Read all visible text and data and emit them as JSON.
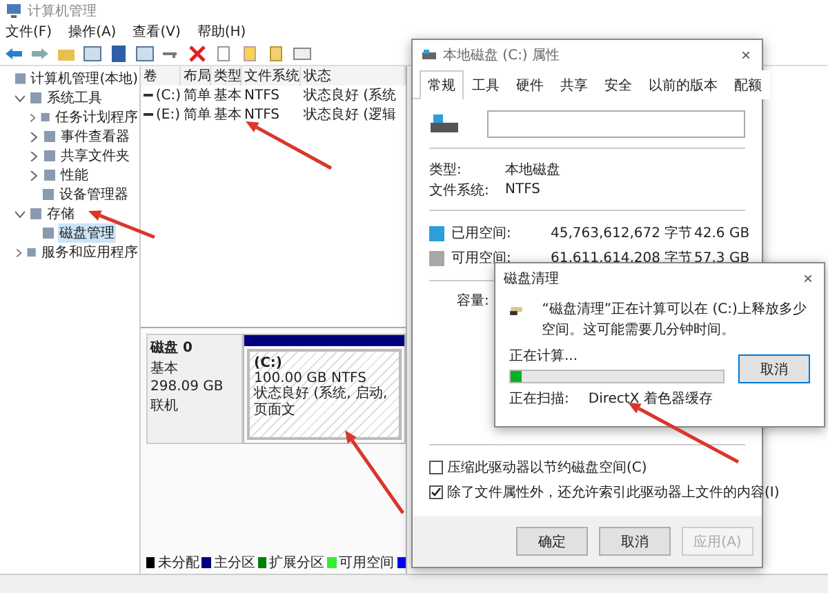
{
  "main_window": {
    "title": "计算机管理",
    "menu": [
      "文件(F)",
      "操作(A)",
      "查看(V)",
      "帮助(H)"
    ],
    "tree": [
      {
        "label": "计算机管理(本地)",
        "selected": false,
        "children": [
          {
            "label": "系统工具",
            "selected": false,
            "expanded": true,
            "children": [
              {
                "label": "任务计划程序",
                "selected": false,
                "expanded": false
              },
              {
                "label": "事件查看器",
                "selected": false,
                "expanded": false
              },
              {
                "label": "共享文件夹",
                "selected": false,
                "expanded": false
              },
              {
                "label": "性能",
                "selected": false,
                "expanded": false
              },
              {
                "label": "设备管理器",
                "selected": false
              }
            ]
          },
          {
            "label": "存储",
            "selected": false,
            "expanded": true,
            "children": [
              {
                "label": "磁盘管理",
                "selected": true
              }
            ]
          },
          {
            "label": "服务和应用程序",
            "selected": false,
            "expanded": false
          }
        ]
      }
    ],
    "volumes": {
      "columns": [
        "卷",
        "布局",
        "类型",
        "文件系统",
        "状态"
      ],
      "rows": [
        [
          "(C:)",
          "简单",
          "基本",
          "NTFS",
          "状态良好 (系统"
        ],
        [
          "(E:)",
          "简单",
          "基本",
          "NTFS",
          "状态良好 (逻辑"
        ]
      ]
    },
    "disk": {
      "name": "磁盘 0",
      "type": "基本",
      "size": "298.09 GB",
      "status": "联机",
      "partition": {
        "label": "(C:)",
        "size": "100.00 GB NTFS",
        "status": "状态良好 (系统, 启动, 页面文"
      }
    },
    "legend": [
      {
        "label": "未分配",
        "color": "#000000"
      },
      {
        "label": "主分区",
        "color": "#000080"
      },
      {
        "label": "扩展分区",
        "color": "#008000"
      },
      {
        "label": "可用空间",
        "color": "#33ee33"
      },
      {
        "color": "#0000ff"
      }
    ]
  },
  "properties_dialog": {
    "title": "本地磁盘 (C:) 属性",
    "close": "×",
    "tabs": [
      {
        "label": "常规",
        "selected": true
      },
      {
        "label": "工具",
        "selected": false
      },
      {
        "label": "硬件",
        "selected": false
      },
      {
        "label": "共享",
        "selected": false
      },
      {
        "label": "安全",
        "selected": false
      },
      {
        "label": "以前的版本",
        "selected": false
      },
      {
        "label": "配额",
        "selected": false
      }
    ],
    "info": [
      {
        "label": "类型:",
        "value": "本地磁盘"
      },
      {
        "label": "文件系统:",
        "value": "NTFS"
      }
    ],
    "space": [
      {
        "label": "已用空间:",
        "bytes": "45,763,612,672 字节",
        "size": "42.6 GB",
        "color": "#2b9fd9"
      },
      {
        "label": "可用空间:",
        "bytes": "61,611,614,208 字节",
        "size": "57.3 GB",
        "color": "#a8a8a8"
      }
    ],
    "capacity_label": "容量:",
    "options": [
      {
        "label": "压缩此驱动器以节约磁盘空间(C)",
        "checked": false
      },
      {
        "label": "除了文件属性外，还允许索引此驱动器上文件的内容(I)",
        "checked": true
      }
    ],
    "buttons": [
      {
        "label": "确定",
        "disabled": false
      },
      {
        "label": "取消",
        "disabled": false
      },
      {
        "label": "应用(A)",
        "disabled": true
      }
    ]
  },
  "cleanup_dialog": {
    "title": "磁盘清理",
    "close": "×",
    "message": "“磁盘清理”正在计算可以在 (C:)上释放多少空间。这可能需要几分钟时间。",
    "status": "正在计算...",
    "level": 0.05,
    "cancel": "取消",
    "scan_label": "正在扫描:",
    "scan_item": "DirectX 着色器缓存"
  }
}
